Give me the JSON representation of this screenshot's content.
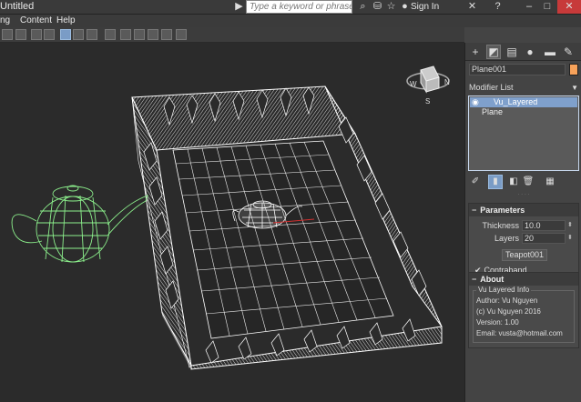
{
  "titlebar": {
    "title": "Untitled",
    "search_placeholder": "Type a keyword or phrase",
    "sign_in": "Sign In"
  },
  "menubar": {
    "items": [
      "ng",
      "Content",
      "Help"
    ]
  },
  "command_panel": {
    "tabs": [
      "create-icon",
      "modify-icon",
      "hierarchy-icon",
      "motion-icon",
      "display-icon",
      "utilities-icon"
    ],
    "object_name": "Plane001",
    "object_color": "#f7a25a",
    "modifier_list_label": "Modifier List",
    "stack": [
      {
        "label": "Vu_Layered",
        "selected": true
      },
      {
        "label": "Plane",
        "selected": false
      }
    ]
  },
  "parameters": {
    "header": "Parameters",
    "thickness_label": "Thickness",
    "thickness_value": "10.0",
    "layers_label": "Layers",
    "layers_value": "20",
    "pick_button": "Teapot001",
    "contraband_label": "Contraband",
    "contraband_checked": true
  },
  "about": {
    "header": "About",
    "group_label": "Vu Layered Info",
    "author": "Author: Vu Nguyen",
    "copyright": "(c) Vu Nguyen 2016",
    "version": "Version: 1.00",
    "email": "Email: vusta@hotmail.com"
  },
  "colors": {
    "viewport_bg": "#2b2b2b",
    "wire_white": "#ffffff",
    "teapot_green": "#8cf08c",
    "selection_blue": "#7fa0cc"
  }
}
